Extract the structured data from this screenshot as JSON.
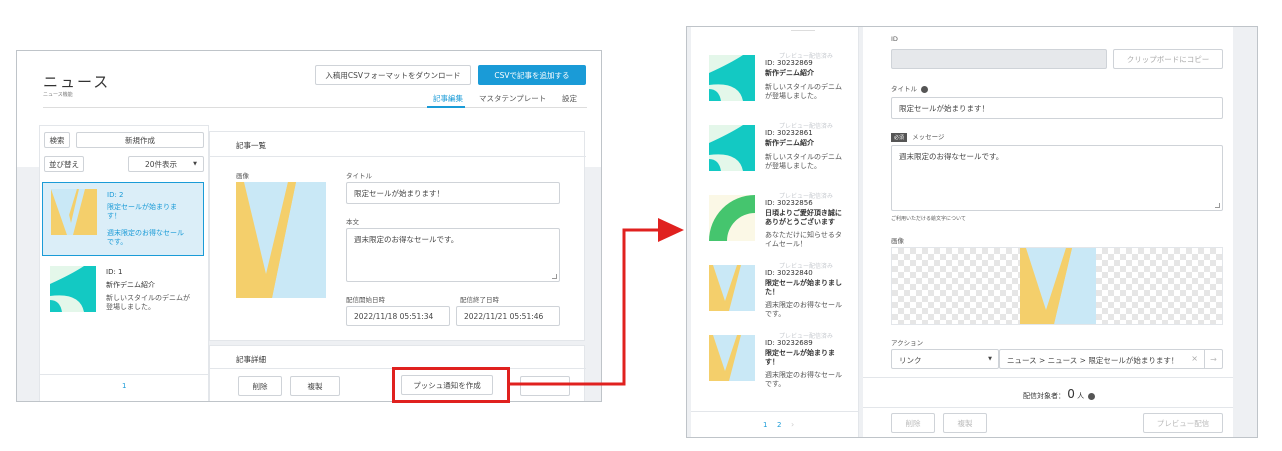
{
  "left": {
    "page_title": "ニュース",
    "breadcrumb": "ニュース機能",
    "download_button": "入稿用CSVフォーマットをダウンロード",
    "add_csv_button": "CSVで記事を追加する",
    "tabs": [
      "記事編集",
      "マスタテンプレート",
      "設定"
    ],
    "search_button": "検索",
    "new_button": "新規作成",
    "sort_button": "並び替え",
    "per_page_select": "20件表示",
    "list": [
      {
        "id": "ID: 2",
        "title": "限定セールが始まります！",
        "message": "週末限定のお得なセールです。"
      },
      {
        "id": "ID: 1",
        "title": "新作デニム紹介",
        "message": "新しいスタイルのデニムが登場しました。"
      }
    ],
    "pagination": "1",
    "article_list_heading": "記事一覧",
    "image_label": "画像",
    "title_label": "タイトル",
    "title_value": "限定セールが始まります！",
    "body_label": "本文",
    "body_value": "週末限定のお得なセールです。",
    "start_label": "配信開始日時",
    "end_label": "配信終了日時",
    "start_value": "2022/11/18 05:51:34",
    "end_value": "2022/11/21 05:51:46",
    "detail_heading": "記事詳細",
    "delete_button": "削除",
    "duplicate_button": "複製",
    "push_button": "プッシュ通知を作成"
  },
  "right": {
    "top_label": "ID",
    "copy_button": "クリップボードにコピー",
    "title_label": "タイトル",
    "title_value": "限定セールが始まります！",
    "required_badge": "必須",
    "message_label": "メッセージ",
    "message_value": "週末限定のお得なセールです。",
    "char_note": "ご利用いただける絵文字について",
    "image_label": "画像",
    "action_label": "アクション",
    "action_type": "リンク",
    "action_path": "ニュース > ニュース > 限定セールが始まります！",
    "target_label": "配信対象者：",
    "target_count": "0",
    "target_unit": "人",
    "delete_button": "削除",
    "duplicate_button": "複製",
    "preview_button": "プレビュー配信",
    "pagination": [
      "1",
      "2"
    ],
    "list": [
      {
        "status": "プレビュー配信済み",
        "id": "ID: 30232869",
        "title": "新作デニム紹介",
        "message": "新しいスタイルのデニムが登場しました。"
      },
      {
        "status": "プレビュー配信済み",
        "id": "ID: 30232861",
        "title": "新作デニム紹介",
        "message": "新しいスタイルのデニムが登場しました。"
      },
      {
        "status": "プレビュー配信済み",
        "id": "ID: 30232856",
        "title": "日頃よりご愛好頂き誠にありがとうございます",
        "message": "あなただけに知らせるタイムセール！"
      },
      {
        "status": "プレビュー配信済み",
        "id": "ID: 30232840",
        "title": "限定セールが始まりました！",
        "message": "週末限定のお得なセールです。"
      },
      {
        "status": "プレビュー配信済み",
        "id": "ID: 30232689",
        "title": "限定セールが始まります！",
        "message": "週末限定のお得なセールです。"
      }
    ]
  },
  "colors": {
    "accent": "#1a9bd7",
    "highlight": "#e0211f",
    "thumb_teal": "#13c9c3",
    "thumb_yellow": "#f4cf6b",
    "thumb_blue": "#c9e8f6",
    "thumb_green": "#45c56e"
  }
}
